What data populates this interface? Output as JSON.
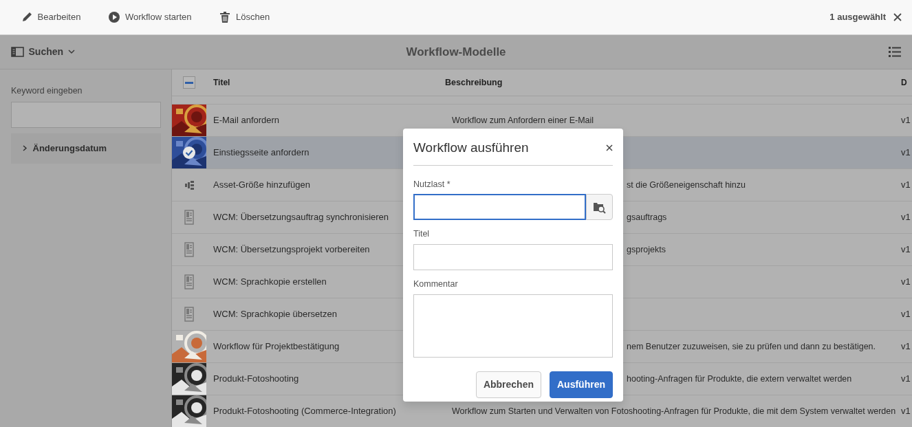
{
  "toolbar": {
    "actions": [
      {
        "kind": "edit",
        "label": "Bearbeiten"
      },
      {
        "kind": "start",
        "label": "Workflow starten"
      },
      {
        "kind": "delete",
        "label": "Löschen"
      }
    ],
    "selection_count": "1 ausgewählt"
  },
  "header": {
    "rail_label": "Suchen",
    "title": "Workflow-Modelle"
  },
  "sidebar": {
    "search_label": "Keyword eingeben",
    "filters": [
      {
        "label": "Änderungsdatum",
        "expanded": false
      }
    ]
  },
  "table": {
    "header_checkbox": {
      "indeterminate": true
    },
    "columns": [
      "Titel",
      "Beschreibung",
      "D"
    ],
    "rows": [
      {
        "kind": "picture",
        "title": "E-Mail anfordern",
        "description": "Workflow zum Anfordern einer E-Mail",
        "version": "v1",
        "selected": false
      },
      {
        "kind": "picture",
        "title": "Einstiegsseite anfordern",
        "version": "v1",
        "selected": true
      },
      {
        "kind": "workflow",
        "title": "Asset-Größe hinzufügen",
        "description": "st die Größeneigenschaft hinzu",
        "behind_dialog": true,
        "version": "v1",
        "selected": false
      },
      {
        "kind": "document",
        "title": "WCM: Übersetzungsauftrag synchronisieren",
        "description": "gsauftrags",
        "behind_dialog": true,
        "version": "v1",
        "selected": false
      },
      {
        "kind": "document",
        "title": "WCM: Übersetzungsprojekt vorbereiten",
        "description": "gsprojekts",
        "behind_dialog": true,
        "version": "v1",
        "selected": false
      },
      {
        "kind": "document",
        "title": "WCM: Sprachkopie erstellen",
        "version": "v1",
        "selected": false
      },
      {
        "kind": "document",
        "title": "WCM: Sprachkopie übersetzen",
        "version": "v1",
        "selected": false
      },
      {
        "kind": "picture",
        "title": "Workflow für Projektbestätigung",
        "description": "nem Benutzer zuzuweisen, sie zu prüfen und dann zu bestätigen.",
        "behind_dialog": true,
        "version": "v1",
        "selected": false
      },
      {
        "kind": "picture",
        "title": "Produkt-Fotoshooting",
        "description": "hooting-Anfragen für Produkte, die extern verwaltet werden",
        "behind_dialog": true,
        "version": "v1",
        "selected": false
      },
      {
        "kind": "picture",
        "title": "Produkt-Fotoshooting (Commerce-Integration)",
        "description": "Workflow zum Starten und Verwalten von Fotoshooting-Anfragen für Produkte, die mit dem System verwaltet werden",
        "version": "v1",
        "selected": false
      }
    ]
  },
  "dialog": {
    "title": "Workflow ausführen",
    "fields": [
      {
        "kind": "browse",
        "label": "Nutzlast *",
        "focused": true
      },
      {
        "kind": "text",
        "label": "Titel",
        "focused": false
      },
      {
        "kind": "textarea",
        "label": "Kommentar",
        "focused": false
      }
    ],
    "buttons": [
      {
        "kind": "secondary",
        "label": "Abbrechen"
      },
      {
        "kind": "primary",
        "label": "Ausführen"
      }
    ]
  }
}
